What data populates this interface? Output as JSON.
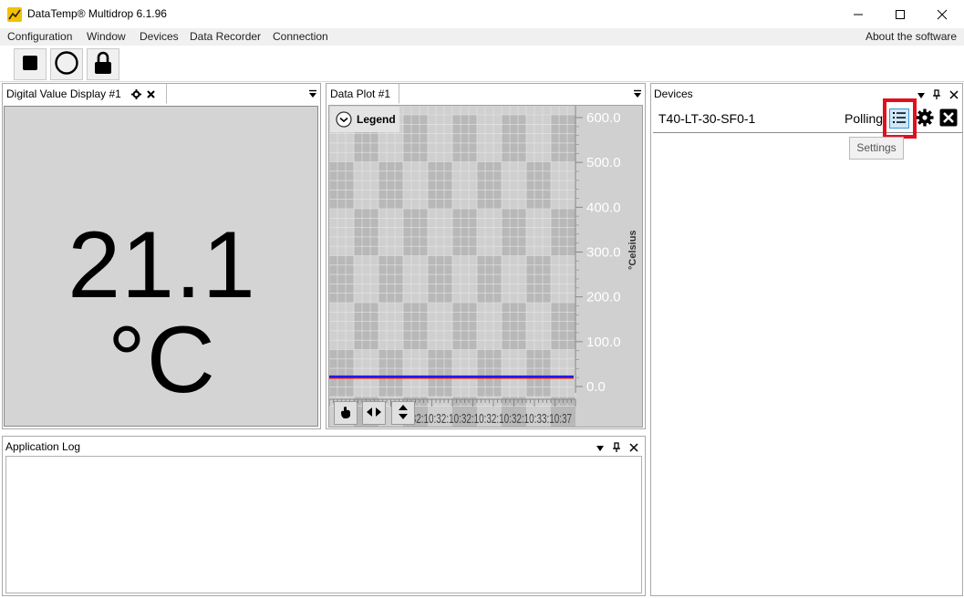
{
  "window": {
    "title": "DataTemp® Multidrop 6.1.96",
    "controls": {
      "minimize": "—",
      "maximize": "☐",
      "close": "✕"
    }
  },
  "menubar": {
    "items": [
      "Configuration",
      "Window",
      "Devices",
      "Data Recorder",
      "Connection"
    ],
    "right_item": "About the software"
  },
  "toolbar": {
    "buttons": [
      {
        "icon": "stop-icon"
      },
      {
        "icon": "record-icon"
      },
      {
        "icon": "lock-icon"
      }
    ]
  },
  "digital_display": {
    "tab_title": "Digital Value Display #1",
    "value": "21.1 °C"
  },
  "data_plot": {
    "tab_title": "Data Plot #1",
    "legend_label": "Legend",
    "y_axis_label": "°Celsius",
    "y_ticks": [
      "600.0",
      "500.0",
      "400.0",
      "300.0",
      "200.0",
      "100.0",
      "0.0"
    ],
    "x_tick_text": "10:32:10:32:10:32:10:32:10:32:10:33:10:37",
    "series_colors": {
      "series1": "#1a1aff",
      "series2": "#e00000"
    }
  },
  "app_log": {
    "title": "Application Log"
  },
  "devices": {
    "title": "Devices",
    "device": {
      "name": "T40-LT-30-SF0-1",
      "status": "Polling"
    },
    "tooltip": "Settings",
    "highlight_color": "#e0101e"
  }
}
